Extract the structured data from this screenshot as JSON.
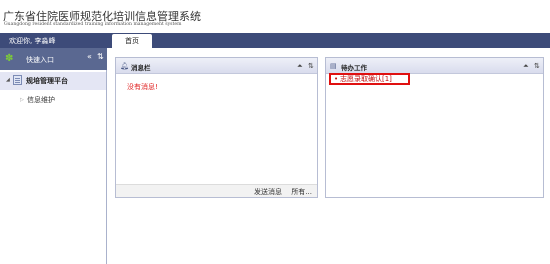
{
  "header": {
    "system_title": "广东省住院医师规范化培训信息管理系统",
    "system_subtitle": "Guangdong resident standardized training information management system"
  },
  "topbar": {
    "welcome_text": "欢迎你, 李淼峰",
    "tabs": [
      {
        "label": "首页",
        "active": true
      }
    ]
  },
  "sidebar": {
    "title": "快速入口",
    "collapse_icon": "double-chevron-left-icon",
    "refresh_icon": "refresh-icon",
    "tree": [
      {
        "label": "规培管理平台",
        "expanded": true
      },
      {
        "label": "信息维护",
        "expanded": false
      }
    ]
  },
  "message_panel": {
    "title": "消息栏",
    "empty_text": "没有消息!",
    "send_label": "发送消息",
    "all_label": "所有..."
  },
  "todo_panel": {
    "title": "待办工作",
    "items": [
      {
        "label": "志愿录取确认[1]"
      }
    ]
  },
  "colors": {
    "topbar": "#3d4b79",
    "sidebar_header": "#5a6891",
    "alert_red": "#e02020",
    "highlight_border": "#e01010"
  }
}
